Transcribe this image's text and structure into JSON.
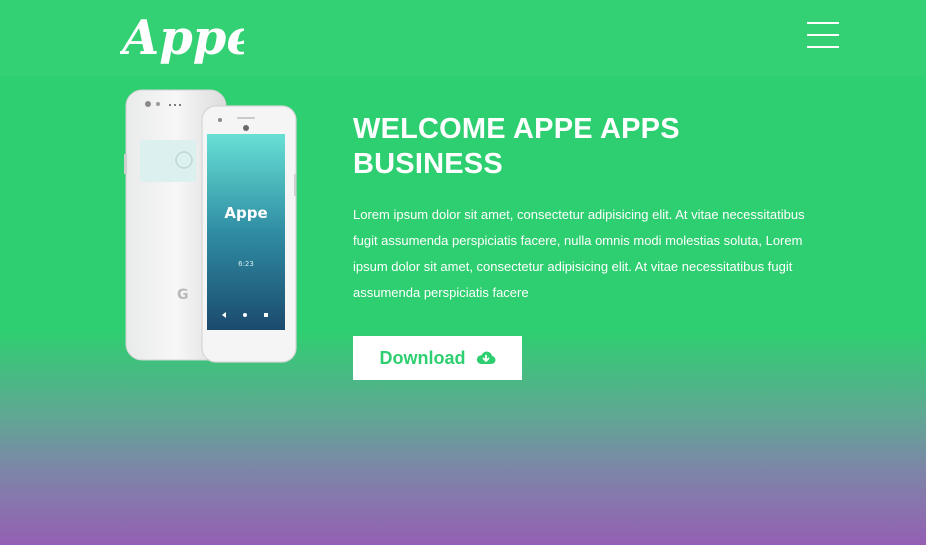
{
  "brand": {
    "logo_text": "Appe",
    "accent": "#2ecf70",
    "gradient_bottom": "#9460b4"
  },
  "nav": {
    "menu_icon": "hamburger-menu-icon"
  },
  "hero": {
    "title": "WELCOME APPE APPS BUSINESS",
    "description": "Lorem ipsum dolor sit amet, consectetur adipisicing elit. At vitae necessitatibus fugit assumenda perspiciatis facere, nulla omnis modi molestias soluta, Lorem ipsum dolor sit amet, consectetur adipisicing elit. At vitae necessitatibus fugit assumenda perspiciatis facere",
    "download_label": "Download",
    "download_icon": "cloud-download-icon"
  },
  "phone_screen": {
    "app_name": "Appe",
    "time_text": "6:23"
  }
}
